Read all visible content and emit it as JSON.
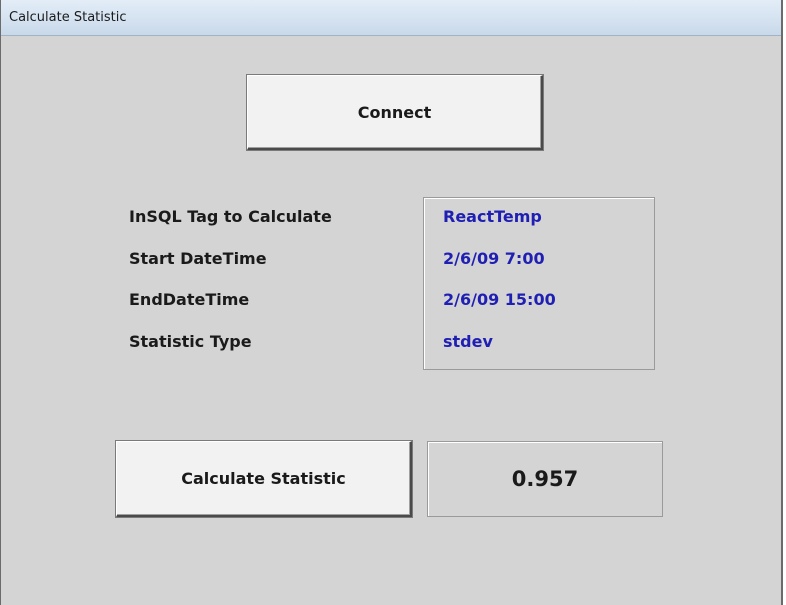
{
  "window": {
    "title": "Calculate Statistic"
  },
  "buttons": {
    "connect_label": "Connect",
    "calculate_label": "Calculate Statistic"
  },
  "fields": [
    {
      "label": "InSQL Tag to Calculate",
      "value": "ReactTemp"
    },
    {
      "label": "Start DateTime",
      "value": "2/6/09 7:00"
    },
    {
      "label": "EndDateTime",
      "value": "2/6/09 15:00"
    },
    {
      "label": "Statistic Type",
      "value": "stdev"
    }
  ],
  "result": {
    "value": "0.957"
  },
  "colors": {
    "background": "#d4d4d4",
    "value_text": "#1f1fb4"
  }
}
